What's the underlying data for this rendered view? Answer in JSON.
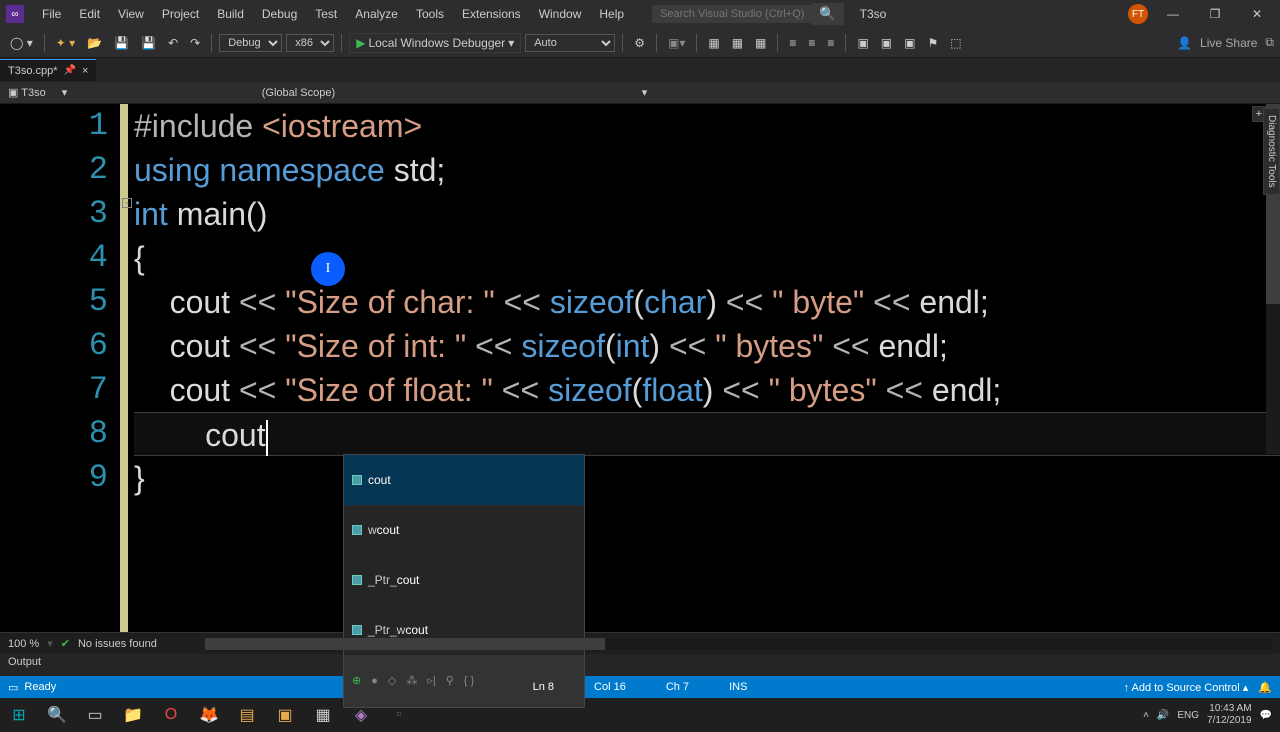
{
  "title": {
    "project": "T3so"
  },
  "menu": [
    "File",
    "Edit",
    "View",
    "Project",
    "Build",
    "Debug",
    "Test",
    "Analyze",
    "Tools",
    "Extensions",
    "Window",
    "Help"
  ],
  "search": {
    "placeholder": "Search Visual Studio (Ctrl+Q)"
  },
  "avatar": {
    "initials": "FT"
  },
  "toolbar": {
    "config": "Debug",
    "platform": "x86",
    "debugger": "Local Windows Debugger",
    "auto": "Auto",
    "liveshare": "Live Share"
  },
  "tab": {
    "name": "T3so.cpp*",
    "close": "×"
  },
  "breadcrumb": {
    "project": "T3so",
    "scope": "(Global Scope)"
  },
  "lines": [
    "1",
    "2",
    "3",
    "4",
    "5",
    "6",
    "7",
    "8",
    "9"
  ],
  "code": {
    "l1": {
      "a": "#include ",
      "b": "<iostream>"
    },
    "l2": {
      "a": "using",
      "b": " namespace",
      "c": " std",
      "d": ";"
    },
    "l3": {
      "a": "int",
      "b": " main",
      "c": "()"
    },
    "l4": {
      "a": "{"
    },
    "l5": {
      "a": "    cout ",
      "b": "<<",
      "c": " \"Size of char: \" ",
      "d": "<<",
      "e": " sizeof",
      "f": "(",
      "g": "char",
      "h": ") ",
      "i": "<<",
      "j": " \" byte\" ",
      "k": "<<",
      "l": " endl;"
    },
    "l6": {
      "a": "    cout ",
      "b": "<<",
      "c": " \"Size of int: \" ",
      "d": "<<",
      "e": " sizeof",
      "f": "(",
      "g": "int",
      "h": ") ",
      "i": "<<",
      "j": " \" bytes\" ",
      "k": "<<",
      "l": " endl;"
    },
    "l7": {
      "a": "    cout ",
      "b": "<<",
      "c": " \"Size of float: \" ",
      "d": "<<",
      "e": " sizeof",
      "f": "(",
      "g": "float",
      "h": ") ",
      "i": "<<",
      "j": " \" bytes\" ",
      "k": "<<",
      "l": " endl;"
    },
    "l8": {
      "a": "        cout"
    },
    "l9": {
      "a": "}"
    }
  },
  "intellisense": {
    "items": [
      {
        "label": "cout",
        "sel": true
      },
      {
        "label": "wcout"
      },
      {
        "label": "_Ptr_cout"
      },
      {
        "label": "_Ptr_wcout"
      }
    ]
  },
  "editor_status": {
    "zoom": "100 %",
    "issues": "No issues found"
  },
  "output": {
    "label": "Output"
  },
  "status": {
    "ready": "Ready",
    "ln": "Ln 8",
    "col": "Col 16",
    "ch": "Ch 7",
    "ins": "INS",
    "add_source": "Add to Source Control"
  },
  "diag": {
    "label": "Diagnostic Tools"
  },
  "tray": {
    "lang": "ENG",
    "time": "10:43 AM",
    "date": "7/12/2019",
    "speaker": "🔊"
  }
}
